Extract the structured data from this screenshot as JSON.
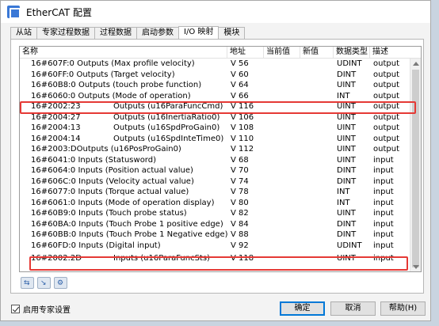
{
  "window": {
    "title": "EtherCAT 配置"
  },
  "tabs": [
    {
      "label": "从站"
    },
    {
      "label": "专家过程数据"
    },
    {
      "label": "过程数据"
    },
    {
      "label": "启动参数"
    },
    {
      "label": "I/O 映射"
    },
    {
      "label": "模块"
    }
  ],
  "table": {
    "headers": {
      "name": "名称",
      "address": "地址",
      "current": "当前值",
      "new": "新值",
      "type": "数据类型",
      "desc": "描述"
    },
    "rows": [
      {
        "name": "16#607F:0 Outputs (Max profile velocity)",
        "extra": "",
        "address": "V 56",
        "type": "UDINT",
        "desc": "output"
      },
      {
        "name": "16#60FF:0 Outputs (Target velocity)",
        "extra": "",
        "address": "V 60",
        "type": "DINT",
        "desc": "output"
      },
      {
        "name": "16#60B8:0 Outputs (touch probe function)",
        "extra": "",
        "address": "V 64",
        "type": "UINT",
        "desc": "output"
      },
      {
        "name": "16#6060:0 Outputs (Mode of operation)",
        "extra": "",
        "address": "V 66",
        "type": "INT",
        "desc": "output"
      },
      {
        "name": "16#2002:23",
        "extra": "Outputs (u16ParaFuncCmd)",
        "address": "V 116",
        "type": "UINT",
        "desc": "output"
      },
      {
        "name": "16#2004:27",
        "extra": "Outputs (u16InertiaRatio0)",
        "address": "V 106",
        "type": "UINT",
        "desc": "output"
      },
      {
        "name": "16#2004:13",
        "extra": "Outputs (u16SpdProGain0)",
        "address": "V 108",
        "type": "UINT",
        "desc": "output"
      },
      {
        "name": "16#2004:14",
        "extra": "Outputs (u16SpdInteTime0)",
        "address": "V 110",
        "type": "UINT",
        "desc": "output"
      },
      {
        "name": "16#2003:DOutputs (u16PosProGain0)",
        "extra": "",
        "address": "V 112",
        "type": "UINT",
        "desc": "output"
      },
      {
        "name": "16#6041:0 Inputs (Statusword)",
        "extra": "",
        "address": "V 68",
        "type": "UINT",
        "desc": "input"
      },
      {
        "name": "16#6064:0 Inputs (Position actual value)",
        "extra": "",
        "address": "V 70",
        "type": "DINT",
        "desc": "input"
      },
      {
        "name": "16#606C:0 Inputs (Velocity actual value)",
        "extra": "",
        "address": "V 74",
        "type": "DINT",
        "desc": "input"
      },
      {
        "name": "16#6077:0 Inputs (Torque actual value)",
        "extra": "",
        "address": "V 78",
        "type": "INT",
        "desc": "input"
      },
      {
        "name": "16#6061:0 Inputs (Mode of operation display)",
        "extra": "",
        "address": "V 80",
        "type": "INT",
        "desc": "input"
      },
      {
        "name": "16#60B9:0 Inputs (Touch probe status)",
        "extra": "",
        "address": "V 82",
        "type": "UINT",
        "desc": "input"
      },
      {
        "name": "16#60BA:0 Inputs (Touch Probe 1 positive edge)",
        "extra": "",
        "address": "V 84",
        "type": "DINT",
        "desc": "input"
      },
      {
        "name": "16#60BB:0 Inputs (Touch Probe 1 Negative edge)",
        "extra": "",
        "address": "V 88",
        "type": "DINT",
        "desc": "input"
      },
      {
        "name": "16#60FD:0 Inputs (Digital input)",
        "extra": "",
        "address": "V 92",
        "type": "UDINT",
        "desc": "input"
      },
      {
        "name": "16#2002:2D",
        "extra": "Inputs (u16ParaFuncSts)",
        "address": "V 118",
        "type": "UINT",
        "desc": "input"
      }
    ]
  },
  "footer": {
    "expert_checkbox_label": "启用专家设置",
    "ok_label": "确定",
    "cancel_label": "取消",
    "help_label": "帮助(H)"
  },
  "colors": {
    "highlight": "#e53935",
    "accent": "#0078d7"
  }
}
